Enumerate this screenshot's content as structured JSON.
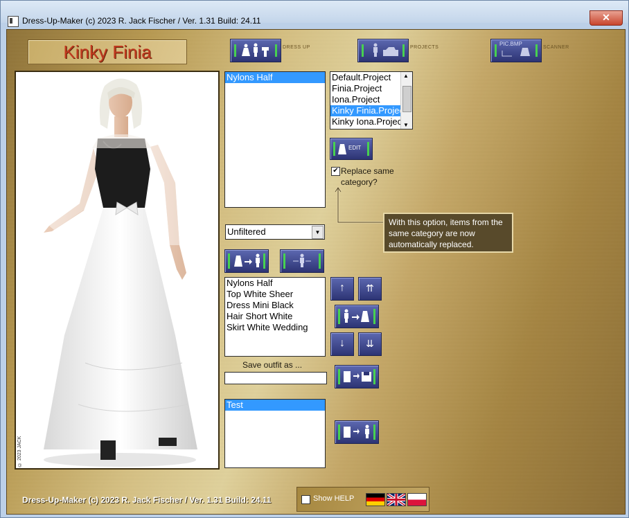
{
  "window": {
    "title": "Dress-Up-Maker (c) 2023 R. Jack Fischer / Ver. 1.31 Build: 24.11",
    "close_glyph": "✕"
  },
  "character": {
    "name": "Kinky Finia",
    "copyright": "© 2023 JACK"
  },
  "modes": [
    {
      "icon": "dress-up-icon",
      "label": "DRESS UP"
    },
    {
      "icon": "projects-icon",
      "label": "PROJECTS"
    },
    {
      "icon": "scanner-icon",
      "label": "SCANNER",
      "badge": "PIC.BMP"
    }
  ],
  "category_list": {
    "items": [
      "Nylons Half"
    ],
    "selected": 0
  },
  "filter": {
    "value": "Unfiltered"
  },
  "outfit_list": {
    "items": [
      "Nylons Half",
      "Top White Sheer",
      "Dress Mini Black",
      "Hair Short White",
      "Skirt White Wedding"
    ]
  },
  "projects": {
    "items": [
      "Default.Project",
      "Finia.Project",
      "Iona.Project",
      "Kinky Finia.Project",
      "Kinky Iona.Project"
    ],
    "selected": 3
  },
  "edit_button": {
    "label": "EDIT"
  },
  "replace_option": {
    "label_line1": "Replace same",
    "label_line2": "category?",
    "checked": true
  },
  "tooltip": {
    "text": "With this option, items from the same category are now automatically replaced."
  },
  "save": {
    "label": "Save outfit as ...",
    "value": ""
  },
  "saved_list": {
    "items": [
      "Test"
    ],
    "selected": 0
  },
  "footer": {
    "text": "Dress-Up-Maker (c) 2023 R. Jack Fischer / Ver. 1.31 Build: 24.11",
    "show_help_label": "Show HELP",
    "show_help_checked": false
  },
  "languages": [
    "german-flag",
    "uk-flag",
    "polish-flag"
  ],
  "colors": {
    "selection": "#3399ff",
    "accent_green": "#47d150",
    "button_blue": "#2d3474",
    "name_red": "#c0391f"
  }
}
